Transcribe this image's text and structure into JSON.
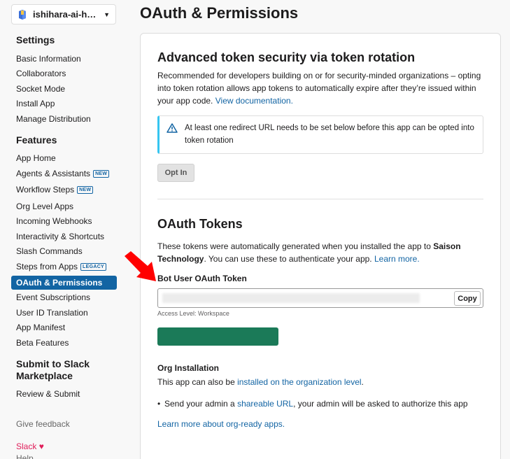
{
  "app": {
    "name": "ishihara-ai-han..."
  },
  "sidebar": {
    "settings_title": "Settings",
    "settings_items": [
      "Basic Information",
      "Collaborators",
      "Socket Mode",
      "Install App",
      "Manage Distribution"
    ],
    "features_title": "Features",
    "features_items": [
      {
        "label": "App Home",
        "badge": ""
      },
      {
        "label": "Agents & Assistants",
        "badge": "NEW"
      },
      {
        "label": "Workflow Steps",
        "badge": "NEW"
      },
      {
        "label": "Org Level Apps",
        "badge": ""
      },
      {
        "label": "Incoming Webhooks",
        "badge": ""
      },
      {
        "label": "Interactivity & Shortcuts",
        "badge": ""
      },
      {
        "label": "Slash Commands",
        "badge": ""
      },
      {
        "label": "Steps from Apps",
        "badge": "LEGACY"
      },
      {
        "label": "OAuth & Permissions",
        "badge": ""
      },
      {
        "label": "Event Subscriptions",
        "badge": ""
      },
      {
        "label": "User ID Translation",
        "badge": ""
      },
      {
        "label": "App Manifest",
        "badge": ""
      },
      {
        "label": "Beta Features",
        "badge": ""
      }
    ],
    "submit_title_1": "Submit to Slack",
    "submit_title_2": "Marketplace",
    "submit_item": "Review & Submit",
    "give_feedback": "Give feedback",
    "slack_link": "Slack",
    "help_link": "Help"
  },
  "page": {
    "title": "OAuth & Permissions",
    "rotation": {
      "heading": "Advanced token security via token rotation",
      "desc": "Recommended for developers building on or for security-minded organizations – opting into token rotation allows app tokens to automatically expire after they’re issued within your app code.",
      "doc_link": "View documentation.",
      "notice": "At least one redirect URL needs to be set below before this app can be opted into token rotation",
      "opt_in": "Opt In"
    },
    "tokens": {
      "heading": "OAuth Tokens",
      "desc_pre": "These tokens were automatically generated when you installed the app to ",
      "org": "Saison Technology",
      "desc_post": ". You can use these to authenticate your app. ",
      "learn_more": "Learn more.",
      "bot_label": "Bot User OAuth Token",
      "copy": "Copy",
      "access_level": "Access Level: Workspace"
    },
    "org_install": {
      "heading": "Org Installation",
      "text_pre": "This app can also be ",
      "link": "installed on the organization level",
      "text_post": ".",
      "bullet_pre": "Send your admin a ",
      "bullet_link": "shareable URL",
      "bullet_post": ", your admin will be asked to authorize this app",
      "learn_link": "Learn more about org-ready apps."
    }
  },
  "colors": {
    "accent": "#1264a3",
    "green": "#1b7a58",
    "arrow": "#ff0000",
    "slack_pink": "#e01e5a"
  }
}
